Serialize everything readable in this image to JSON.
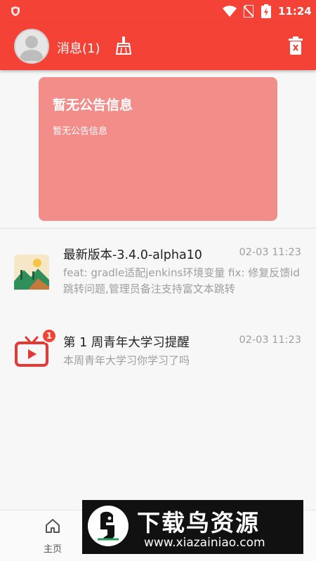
{
  "status_bar": {
    "time": "11:24",
    "icons": [
      "shield-icon",
      "wifi-icon",
      "no-sim-icon",
      "battery-charging-icon"
    ]
  },
  "app_bar": {
    "title": "消息(1)",
    "left_icons": [
      "avatar",
      "broom-icon"
    ],
    "right_icons": [
      "trash-icon"
    ]
  },
  "notice": {
    "title": "暂无公告信息",
    "body": "暂无公告信息"
  },
  "messages": [
    {
      "title": "最新版本-3.4.0-alpha10",
      "time": "02-03 11:23",
      "body": "feat: gradle适配jenkins环境变量 fix: 修复反馈id跳转问题,管理员备注支持富文本跳转",
      "icon": "landscape-thumbnail-icon"
    },
    {
      "title": "第 1 周青年大学习提醒",
      "time": "02-03 11:23",
      "body": "本周青年大学习你学习了吗",
      "icon": "tv-play-icon",
      "badge": "1"
    }
  ],
  "bottom_nav": {
    "home_label": "主页"
  },
  "watermark": {
    "title": "下载鸟资源",
    "url": "www.xiazainiao.com"
  },
  "colors": {
    "primary": "#f44336",
    "notice_card": "#f38d8a",
    "secondary_text": "#9e9e9e"
  }
}
